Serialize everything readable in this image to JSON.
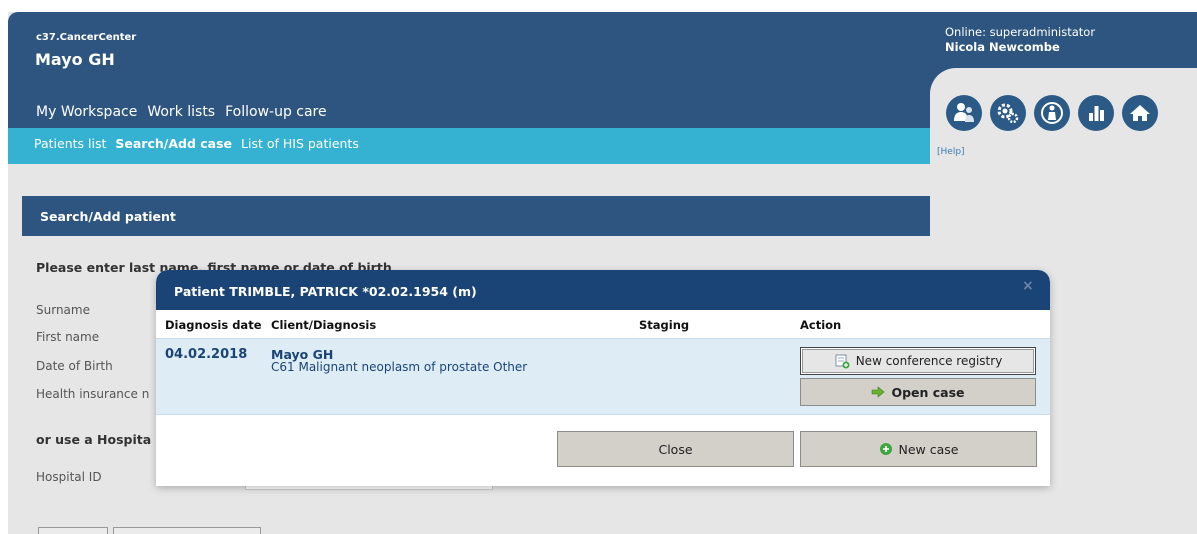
{
  "header": {
    "app_name": "c37.CancerCenter",
    "org": "Mayo GH",
    "online_status": "Online: superadministator",
    "user_name": "Nicola Newcombe"
  },
  "main_nav": [
    "My Workspace",
    "Work lists",
    "Follow-up care"
  ],
  "sub_nav": {
    "items": [
      "Patients list",
      "Search/Add case",
      "List of HIS patients"
    ],
    "active": "Search/Add case"
  },
  "toolbar": {
    "icons": [
      "user-group-icon",
      "gears-icon",
      "person-cycle-icon",
      "bar-chart-icon",
      "home-icon"
    ],
    "help_label": "[Help]"
  },
  "search_panel": {
    "title": "Search/Add patient",
    "instruction": "Please enter last name, first name or date of birth",
    "fields": [
      "Surname",
      "First name",
      "Date of Birth",
      "Health insurance n"
    ],
    "or_hospital_label": "or use a Hospita",
    "hospital_id_label": "Hospital ID"
  },
  "modal": {
    "title": "Patient TRIMBLE, PATRICK *02.02.1954 (m)",
    "close_icon": "×",
    "columns": [
      "Diagnosis date",
      "Client/Diagnosis",
      "Staging",
      "Action"
    ],
    "row": {
      "diagnosis_date": "04.02.2018",
      "client": "Mayo GH",
      "diagnosis": "C61 Malignant neoplasm of prostate  Other",
      "staging": ""
    },
    "buttons": {
      "new_conference": "New conference registry",
      "open_case": "Open case",
      "close": "Close",
      "new_case": "New case"
    }
  },
  "colors": {
    "header_navy": "#2d557f",
    "subnav_cyan": "#35b2d2",
    "modal_header": "#1b4476",
    "row_highlight": "#deedf5",
    "button_face": "#d3cfc9",
    "page_gray": "#e6e6e6",
    "new_case_green": "#3fa63f",
    "open_case_arrow": "#6ab12f"
  }
}
